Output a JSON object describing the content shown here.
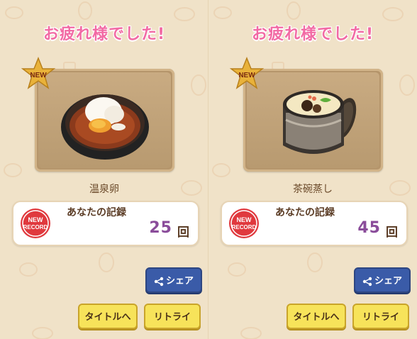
{
  "panels": [
    {
      "title": "お疲れ様でした!",
      "badge_text": "NEW",
      "food_name": "温泉卵",
      "record_badge": [
        "NEW",
        "RECORD"
      ],
      "record_label": "あなたの記録",
      "record_count": "25",
      "record_unit": "回",
      "share_label": "シェア",
      "title_button": "タイトルへ",
      "retry_button": "リトライ",
      "dish_icon": "onsen-egg-bowl"
    },
    {
      "title": "お疲れ様でした!",
      "badge_text": "NEW",
      "food_name": "茶碗蒸し",
      "record_badge": [
        "NEW",
        "RECORD"
      ],
      "record_label": "あなたの記録",
      "record_count": "45",
      "record_unit": "回",
      "share_label": "シェア",
      "title_button": "タイトルへ",
      "retry_button": "リトライ",
      "dish_icon": "chawanmushi-cup"
    }
  ],
  "colors": {
    "title_pink": "#f26aa4",
    "record_purple": "#8a4c9a",
    "share_blue": "#3a5ba8",
    "button_yellow": "#f7e35a",
    "badge_gold": "#e9b23a",
    "record_red": "#e0393e"
  }
}
